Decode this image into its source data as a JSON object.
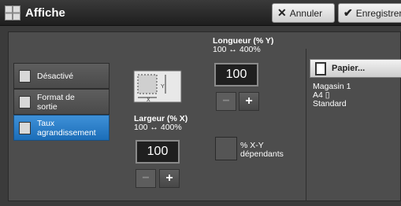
{
  "header": {
    "title": "Affiche",
    "app_icon": "poster-icon",
    "cancel": {
      "icon": "close-icon",
      "label": "Annuler"
    },
    "save": {
      "icon": "check-icon",
      "label": "Enregistrer"
    }
  },
  "sidebar": {
    "items": [
      {
        "label": "Désactivé",
        "icon": "off-icon",
        "active": false
      },
      {
        "label_line1": "Format de",
        "label_line2": "sortie",
        "icon": "output-size-icon",
        "active": false
      },
      {
        "label_line1": "Taux",
        "label_line2": "agrandissement",
        "icon": "enlarge-ratio-icon",
        "active": true
      }
    ]
  },
  "length": {
    "title": "Longueur (% Y)",
    "range": "100 ↔ 400%",
    "value": "100",
    "minus": "−",
    "plus": "+"
  },
  "width": {
    "title": "Largeur (% X)",
    "range": "100 ↔ 400%",
    "value": "100",
    "minus": "−",
    "plus": "+"
  },
  "xy_dependent": {
    "line1": "% X-Y",
    "line2": "dépendants",
    "checked": false
  },
  "paper": {
    "button_label": "Papier...",
    "icon": "paper-icon",
    "tray": "Magasin 1",
    "size": "A4 ▯",
    "type": "Standard"
  },
  "colors": {
    "active": "#1b6db8",
    "panel": "#4d4d4d",
    "header": "#1e1e1e"
  }
}
